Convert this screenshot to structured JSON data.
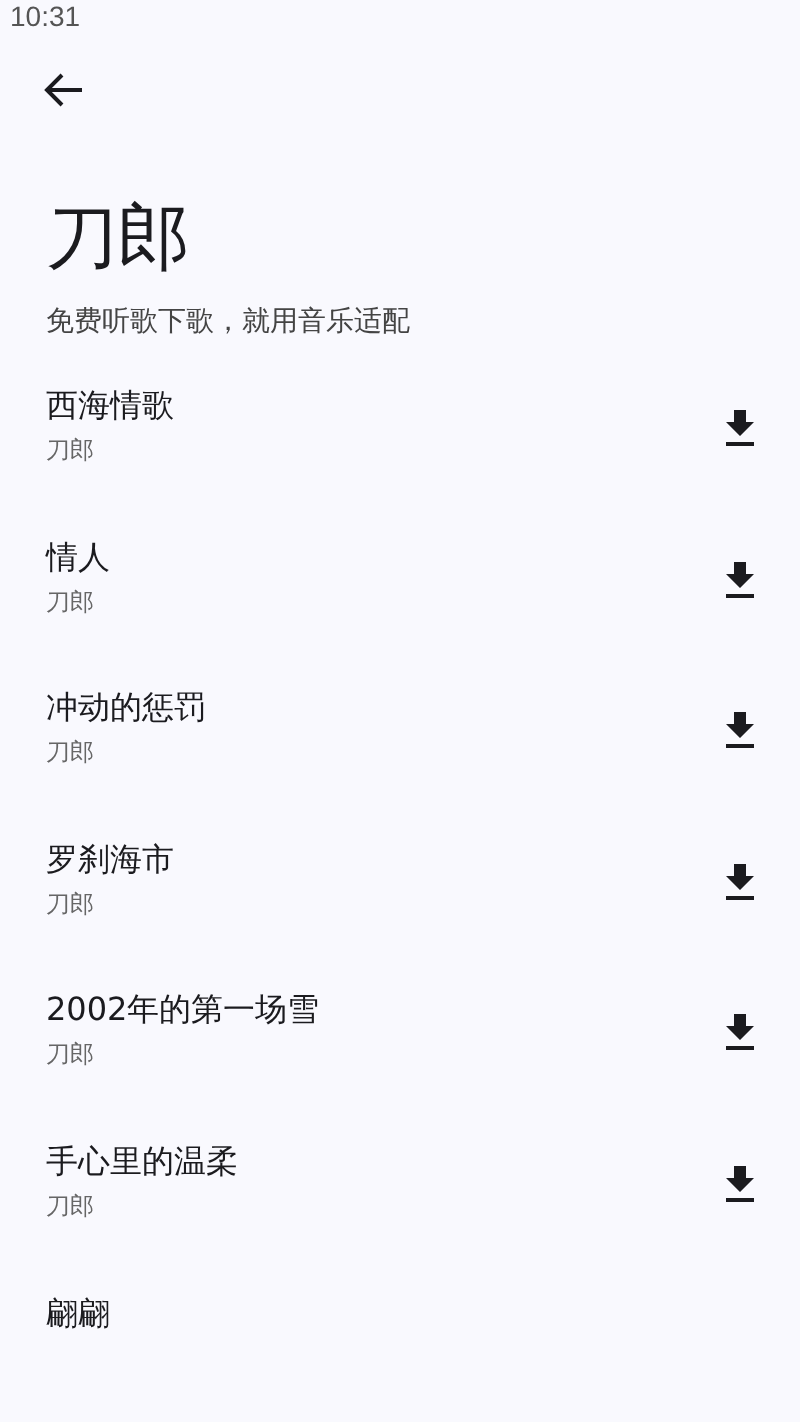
{
  "status_bar": {
    "time": "10:31"
  },
  "header": {
    "title": "刀郎",
    "subtitle": "免费听歌下歌，就用音乐适配"
  },
  "songs": [
    {
      "title": "西海情歌",
      "artist": "刀郎"
    },
    {
      "title": "情人",
      "artist": "刀郎"
    },
    {
      "title": "冲动的惩罚",
      "artist": "刀郎"
    },
    {
      "title": "罗刹海市",
      "artist": "刀郎"
    },
    {
      "title": "2002年的第一场雪",
      "artist": "刀郎"
    },
    {
      "title": "手心里的温柔",
      "artist": "刀郎"
    },
    {
      "title": "翩翩"
    }
  ]
}
